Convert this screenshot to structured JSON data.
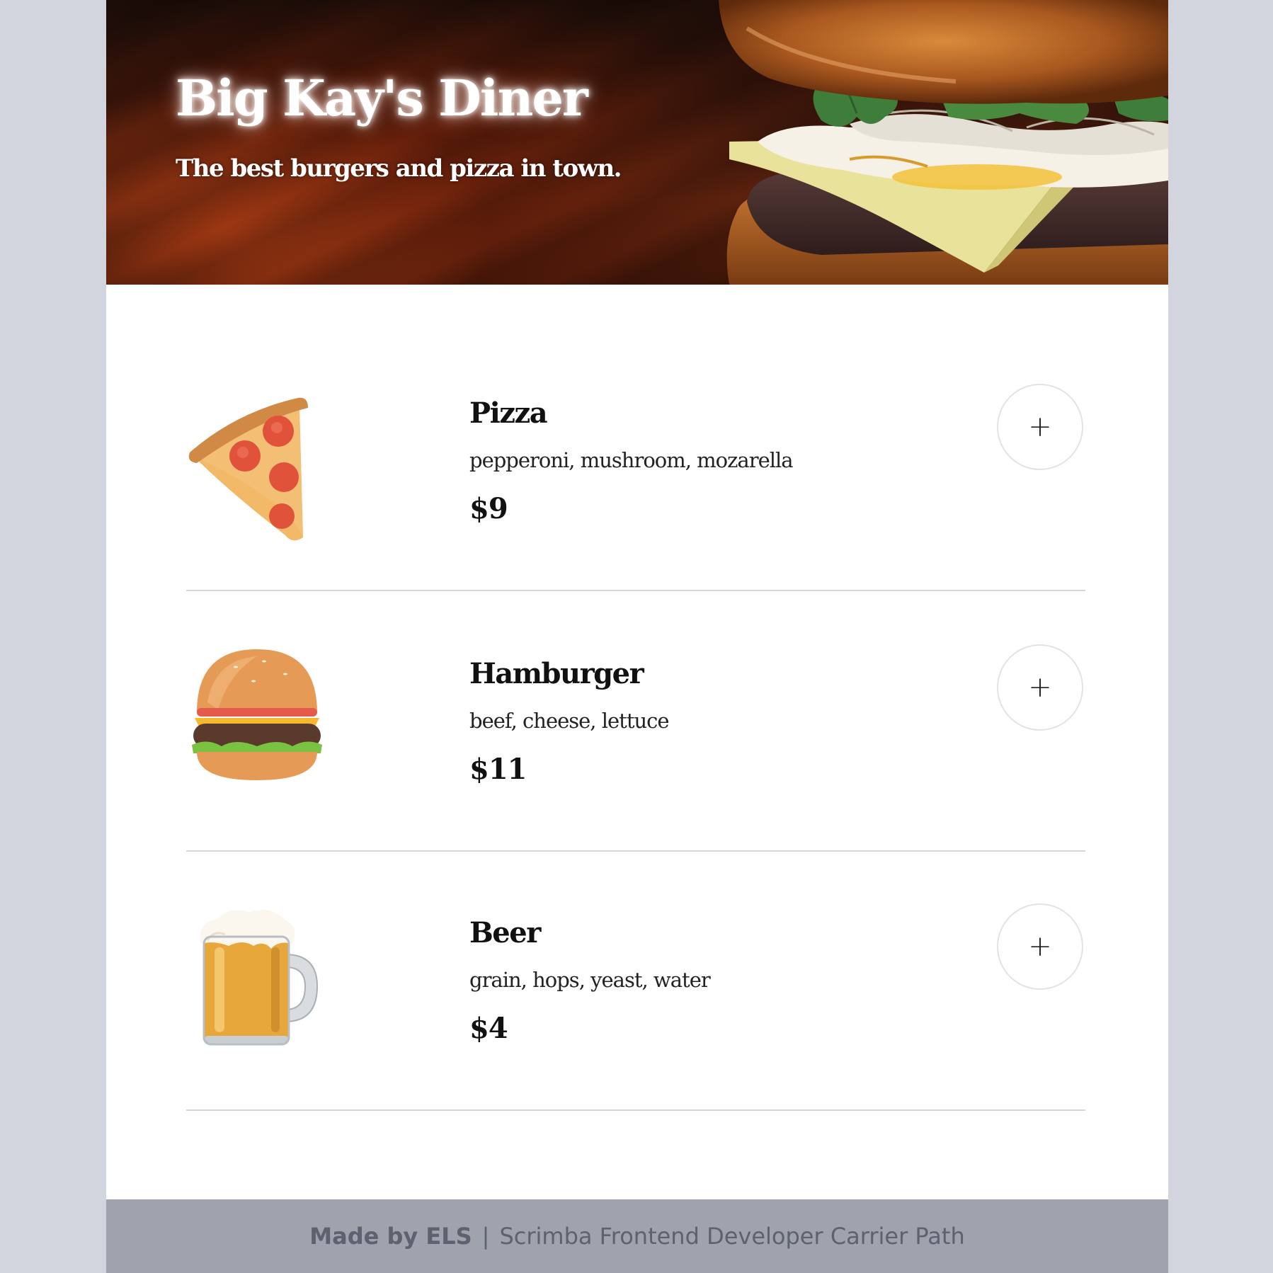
{
  "hero": {
    "title": "Big Kay's Diner",
    "subtitle": "The best burgers and pizza in town."
  },
  "menu": {
    "items": [
      {
        "icon": "pizza-icon",
        "name": "Pizza",
        "ingredients": "pepperoni, mushroom, mozarella",
        "price": "$9",
        "add_label": "+"
      },
      {
        "icon": "hamburger-icon",
        "name": "Hamburger",
        "ingredients": "beef, cheese, lettuce",
        "price": "$11",
        "add_label": "+"
      },
      {
        "icon": "beer-icon",
        "name": "Beer",
        "ingredients": "grain, hops, yeast, water",
        "price": "$4",
        "add_label": "+"
      }
    ]
  },
  "footer": {
    "author": "Made by ELS",
    "separator": "|",
    "text": "Scrimba Frontend Developer Carrier Path"
  },
  "colors": {
    "page_background": "#d2d5de",
    "footer_background": "#9ea3ae",
    "footer_text": "#5d6170",
    "divider": "#d6d6d6"
  }
}
